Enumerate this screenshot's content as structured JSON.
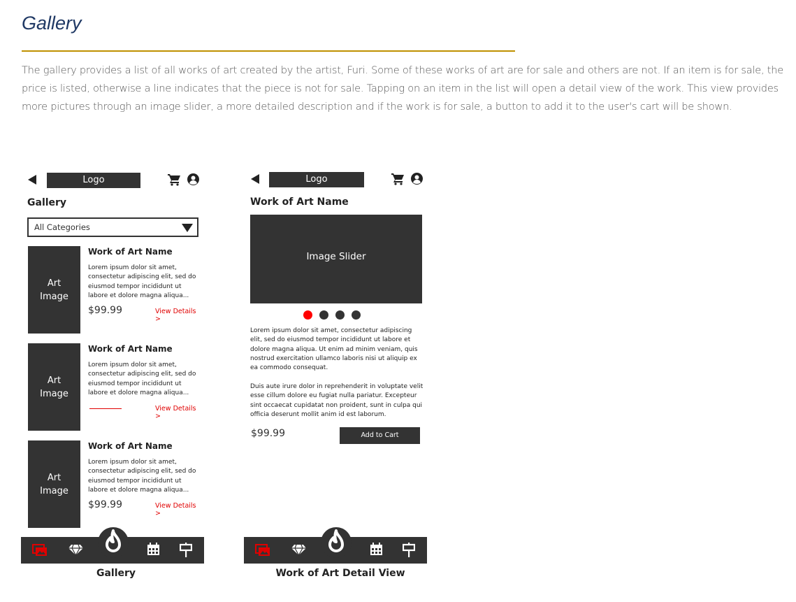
{
  "document": {
    "title": "Gallery",
    "body": "The gallery provides a list of all works of art created by the artist, Furi.  Some of these works of art are for sale and others are not.  If an item is for sale, the price is listed, otherwise a line indicates that the piece is not for sale.  Tapping on an item in the list will open a detail view of the work.  This view provides more pictures through an image slider, a more detailed description and if the work is for sale, a button to add it to the user's cart will be shown.",
    "accent_color": "#bf9000",
    "title_color": "#1f3864"
  },
  "gallery_screen": {
    "header": {
      "logo": "Logo",
      "icons": [
        "back-arrow-icon",
        "cart-icon",
        "user-icon"
      ]
    },
    "title": "Gallery",
    "category_select": "All Categories",
    "items": [
      {
        "image": "Art\nImage",
        "name": "Work of Art Name",
        "description": "Lorem ipsum dolor sit amet, consectetur adipiscing elit, sed do eiusmod tempor incididunt ut labore et dolore magna aliqua...",
        "price": "$99.99",
        "for_sale": true,
        "link": "View Details >"
      },
      {
        "image": "Art\nImage",
        "name": "Work of Art Name",
        "description": "Lorem ipsum dolor sit amet, consectetur adipiscing elit, sed do eiusmod tempor incididunt ut labore et dolore magna aliqua...",
        "price": "",
        "for_sale": false,
        "link": "View Details >"
      },
      {
        "image": "Art\nImage",
        "name": "Work of Art Name",
        "description": "Lorem ipsum dolor sit amet, consectetur adipiscing elit, sed do eiusmod tempor incididunt ut labore et dolore magna aliqua...",
        "price": "$99.99",
        "for_sale": true,
        "link": "View Details >"
      }
    ],
    "nav": [
      "gallery-icon",
      "gem-icon",
      "flame-logo-icon",
      "calendar-icon",
      "signpost-icon"
    ],
    "active_nav": "gallery-icon",
    "caption": "Gallery"
  },
  "detail_screen": {
    "header": {
      "logo": "Logo",
      "icons": [
        "back-arrow-icon",
        "cart-icon",
        "user-icon"
      ]
    },
    "title": "Work of Art Name",
    "slider_label": "Image Slider",
    "slider_dots": 4,
    "active_dot": 1,
    "paragraph1": "Lorem ipsum dolor sit amet, consectetur adipiscing elit, sed do eiusmod tempor incididunt ut labore et dolore magna aliqua. Ut enim ad minim veniam, quis nostrud exercitation ullamco laboris nisi ut aliquip ex ea commodo consequat.",
    "paragraph2": "Duis aute irure dolor in reprehenderit in voluptate velit esse cillum dolore eu fugiat nulla pariatur. Excepteur sint occaecat cupidatat non proident, sunt in culpa qui officia deserunt mollit anim id est laborum.",
    "price": "$99.99",
    "add_to_cart": "Add to Cart",
    "nav": [
      "gallery-icon",
      "gem-icon",
      "flame-logo-icon",
      "calendar-icon",
      "signpost-icon"
    ],
    "active_nav": "gallery-icon",
    "caption": "Work of Art Detail View"
  },
  "colors": {
    "mock_dark": "#333333",
    "active_red": "#e00000"
  }
}
